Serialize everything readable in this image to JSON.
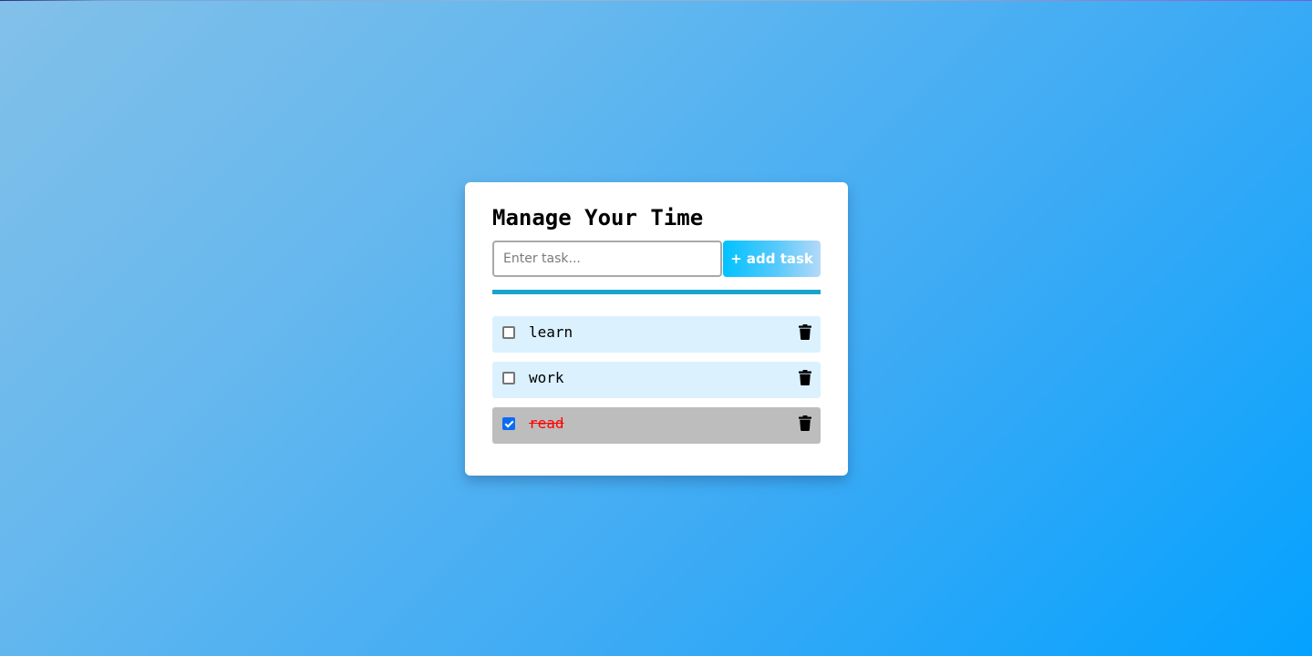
{
  "app": {
    "title": "Manage Your Time"
  },
  "form": {
    "input_value": "",
    "input_placeholder": "Enter task...",
    "add_button_label": "+ add task"
  },
  "tasks": [
    {
      "label": "learn",
      "completed": false,
      "delete_icon": "trash-icon"
    },
    {
      "label": "work",
      "completed": false,
      "delete_icon": "trash-icon"
    },
    {
      "label": "read",
      "completed": true,
      "delete_icon": "trash-icon"
    }
  ],
  "colors": {
    "divider": "#1aa3cf",
    "task_background": "#dbf1fe",
    "completed_task_background": "#bdbdbd",
    "completed_task_text": "#ff0000",
    "checkbox_checked": "#0b6cf2"
  }
}
